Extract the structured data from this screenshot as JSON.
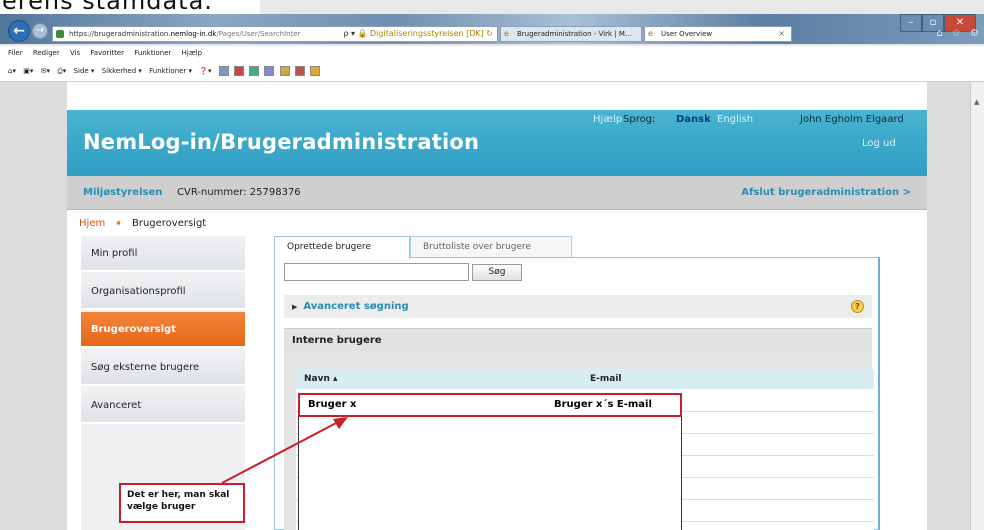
{
  "doc_caption": "erens stamdata.",
  "browser": {
    "address": {
      "url_prefix": "https://brugeradministration.",
      "url_host": "nemlog-in.dk",
      "url_rest": "/Pages/User/SearchInter",
      "controls": "ρ ▾",
      "site_lock": "🔒 Digitaliseringsstyrelsen [DK] ↻"
    },
    "tabs": [
      {
        "label": "Brugeradministration - Virk | M...",
        "icon": "tab-ie-icon"
      },
      {
        "label": "User Overview",
        "icon": "tab-ie-icon",
        "close": "×"
      }
    ],
    "window_controls": [
      "–",
      "▫",
      "✕"
    ],
    "window_icons": "⌂ ☆ ⚙",
    "menu": [
      "Filer",
      "Rediger",
      "Vis",
      "Favoritter",
      "Funktioner",
      "Hjælp"
    ],
    "commands": [
      "Side ▾",
      "Sikkerhed ▾",
      "Funktioner ▾"
    ]
  },
  "page": {
    "title": "NemLog-in/Brugeradministration",
    "help": "Hjælp",
    "language_label": "Sprog:",
    "lang_dansk": "Dansk",
    "lang_english": "English",
    "user_name": "John Egholm Elgaard",
    "logout": "Log ud",
    "org_name": "Miljøstyrelsen",
    "cvr": "CVR-nummer: 25798376",
    "exit_admin": "Afslut brugeradministration >",
    "breadcrumb": {
      "home": "Hjem",
      "sep": "➧",
      "current": "Brugeroversigt"
    },
    "sidebar": [
      {
        "label": "Min profil",
        "active": false
      },
      {
        "label": "Organisationsprofil",
        "active": false
      },
      {
        "label": "Brugeroversigt",
        "active": true
      },
      {
        "label": "Søg eksterne brugere",
        "active": false
      },
      {
        "label": "Avanceret",
        "active": false
      }
    ],
    "tabs": [
      "Oprettede brugere",
      "Bruttoliste over brugere"
    ],
    "search": {
      "value": "",
      "button": "Søg"
    },
    "advanced_search": "Avanceret søgning",
    "advanced_arrow": "▶",
    "help_icon_glyph": "?",
    "section_title": "Interne brugere",
    "table": {
      "columns": [
        "Navn ▴",
        "E-mail"
      ],
      "selected_row": {
        "name": "Bruger x",
        "email": "Bruger x´s E-mail"
      }
    }
  },
  "annotation": {
    "text_line1": "Det er her, man skal",
    "text_line2": "vælge bruger",
    "color": "#c8202a"
  },
  "colors": {
    "banner": "#2f9ec3",
    "active_nav": "#e46619",
    "link": "#2a8cb4",
    "highlight_border": "#c8202a"
  }
}
